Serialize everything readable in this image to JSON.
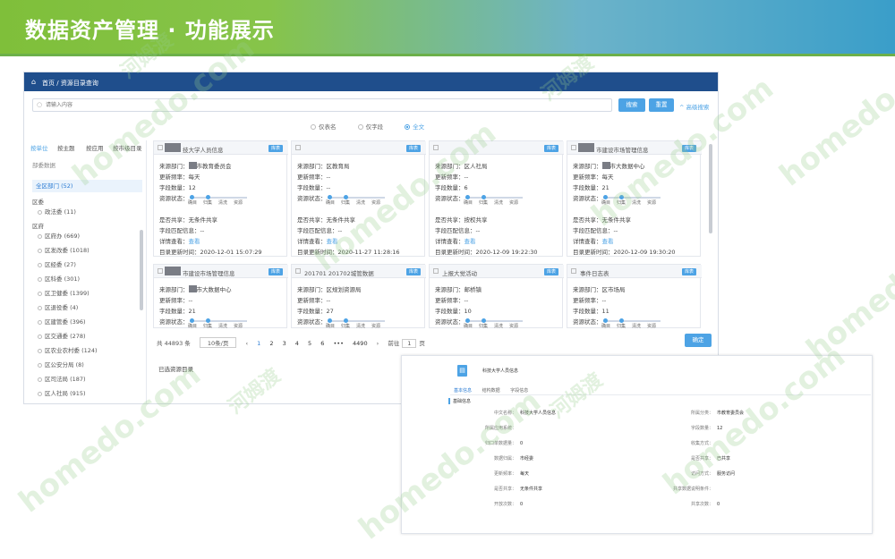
{
  "banner": {
    "title": "数据资产管理 · 功能展示"
  },
  "nav": {
    "home": "首页",
    "crumb": "/ 资源目录查询"
  },
  "search": {
    "placeholder": "请输入内容",
    "search_button": "搜索",
    "reset_button": "重置",
    "advanced": "^ 高级搜索"
  },
  "radios": [
    {
      "label": "仅表名",
      "checked": false
    },
    {
      "label": "仅字段",
      "checked": false
    },
    {
      "label": "全文",
      "checked": true
    }
  ],
  "sidebar": {
    "tabs": [
      "按单位",
      "按主题",
      "按应用",
      "按市级目录"
    ],
    "subtitle": "部委数据",
    "all": "全区部门 (52)",
    "groups": [
      {
        "name": "区委",
        "items": [
          "政法委 (11)"
        ]
      },
      {
        "name": "区府",
        "items": [
          "区府办 (669)",
          "区发改委 (1018)",
          "区经委 (27)",
          "区科委 (301)",
          "区卫健委 (1399)",
          "区退役委 (4)",
          "区建管委 (396)",
          "区交通委 (278)",
          "区农业农村委 (124)",
          "区公安分局 (8)",
          "区司法局 (187)",
          "区人社局 (915)"
        ]
      }
    ]
  },
  "card_labels": {
    "source": "来源部门：",
    "freq": "更新频率：",
    "fields": "字段数量：",
    "status": "资源状态：",
    "share": "是否共享：",
    "match": "字段匹配信息：",
    "detail": "详情查看：",
    "updated": "目录更新时间：",
    "detail_link": "查看",
    "tag": "库表",
    "steps": [
      "确目",
      "归集",
      "清洗",
      "资源"
    ]
  },
  "cards": [
    {
      "title": "技大学人员信息",
      "source": "市教育委员会",
      "freq": "每天",
      "fields": "12",
      "share": "无条件共享",
      "match": "--",
      "updated": "2020-12-01 15:07:29"
    },
    {
      "title": "",
      "source": "区教育局",
      "freq": "--",
      "fields": "--",
      "share": "无条件共享",
      "match": "--",
      "updated": "2020-11-27 11:28:16"
    },
    {
      "title": "",
      "source": "区人社局",
      "freq": "--",
      "fields": "6",
      "share": "按权共享",
      "match": "--",
      "updated": "2020-12-09 19:22:30"
    },
    {
      "title": "市建设市场管理信息",
      "source": "市大数据中心",
      "freq": "每天",
      "fields": "21",
      "share": "无条件共享",
      "match": "--",
      "updated": "2020-12-09 19:30:20"
    },
    {
      "title": "市建设市场管理信息",
      "source": "市大数据中心",
      "freq": "--",
      "fields": "21"
    },
    {
      "title": "201701 201702城管数据",
      "source": "区规划资源局",
      "freq": "--",
      "fields": "27"
    },
    {
      "title": "上报大觉活动",
      "source": "邮桥镇",
      "freq": "--",
      "fields": "10"
    },
    {
      "title": "事件日志表",
      "source": "区市场局",
      "freq": "--",
      "fields": "11"
    }
  ],
  "pager": {
    "total": "共 44893 条",
    "size": "10条/页",
    "pages": [
      "1",
      "2",
      "3",
      "4",
      "5",
      "6",
      "•••",
      "4490"
    ],
    "goto": "前往",
    "goto_value": "1",
    "page_unit": "页",
    "confirm": "确定",
    "selected": "已选资源目录"
  },
  "detail": {
    "title": "科技大学人员信息",
    "tabs": [
      "基本信息",
      "结构数据",
      "字段信息"
    ],
    "section": "基础信息",
    "fields": [
      {
        "label": "中文名称：",
        "value": "科技大学人员信息"
      },
      {
        "label": "所属分类：",
        "value": "市教育委员会"
      },
      {
        "label": "所属应用系统：",
        "value": ""
      },
      {
        "label": "字段数量：",
        "value": "12"
      },
      {
        "label": "归口单数据量：",
        "value": "0"
      },
      {
        "label": "收集方式：",
        "value": ""
      },
      {
        "label": "数据归属：",
        "value": "市经委"
      },
      {
        "label": "是否共享：",
        "value": "已共享"
      },
      {
        "label": "更新频率：",
        "value": "每天"
      },
      {
        "label": "访问方式：",
        "value": "服务访问"
      },
      {
        "label": "是否共享：",
        "value": "无条件共享"
      },
      {
        "label": "共享数据说明条件：",
        "value": ""
      },
      {
        "label": "开放次数：",
        "value": "0"
      },
      {
        "label": "共享次数：",
        "value": "0"
      }
    ]
  },
  "watermark": {
    "text_cn": "河姆渡",
    "text_en": "homedo.com"
  }
}
